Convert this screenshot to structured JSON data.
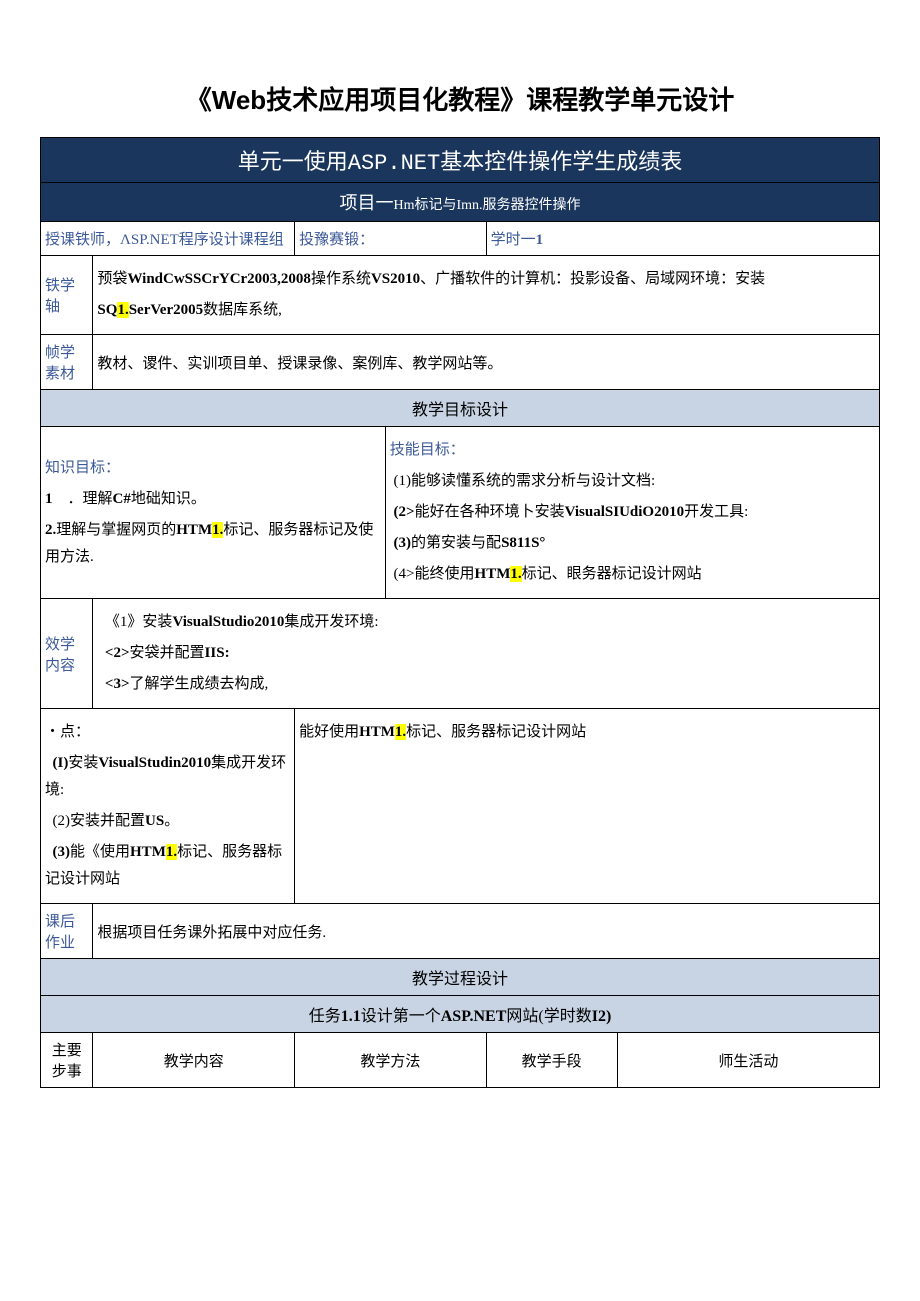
{
  "title": "《Web技术应用项目化教程》课程教学单元设计",
  "banner_pre": "单元一使用",
  "banner_mid": "ASP.NET",
  "banner_post": "基本控件操作学生成绩表",
  "subbanner_pre": "项目一",
  "subbanner_mid1": "Hm",
  "subbanner_mid2": "标记与",
  "subbanner_mid3": "Imn.服务器",
  "subbanner_post": "控件操作",
  "info_teacher": "授课铁师，ΛSP.NET程序设计课程组",
  "info_cast": "投豫赛锻：",
  "info_hours_label": "学时一",
  "info_hours_val": "1",
  "row_env_label": "铁学轴",
  "row_env_1a": "预袋",
  "row_env_1b": "WindCwSSCrYCr2003,2008",
  "row_env_1c": "操作系统",
  "row_env_1d": "VS2010",
  "row_env_1e": "、广播软件的计算机：投影设备、局域网环境：安装",
  "row_env_2a": "SQ",
  "row_env_2b": "1.",
  "row_env_2c": "SerVer2005",
  "row_env_2d": "数据库系统,",
  "row_mat_label": "帧学素材",
  "row_mat_text": "教材、谡件、实训项目单、授课录像、案例库、教学网站等。",
  "section_goal": "教学目标设计",
  "know_title": "知识目标：",
  "know_1_a": "1",
  "know_1_b": "．理解",
  "know_1_c": "C#",
  "know_1_d": "地础知识。",
  "know_2_a": "2.",
  "know_2_b": "理解与掌握网页的",
  "know_2_c": "HTM",
  "know_2_d": "1.",
  "know_2_e": "标记、服务器标记及使用方法.",
  "skill_title": "技能目标：",
  "skill_1": "(1)能够读懂系统的需求分析与设计文档:",
  "skill_2a": "(2>",
  "skill_2b": "能好在各种环境卜安装",
  "skill_2c": "VisualSIUdiO2010",
  "skill_2d": "开发工具:",
  "skill_3a": "(3)",
  "skill_3b": "的第安装与配",
  "skill_3c": "S811S°",
  "skill_4a": "(4>",
  "skill_4b": "能终使用",
  "skill_4c": "HTM",
  "skill_4d": "1.",
  "skill_4e": "标记、眼务器标记设计网站",
  "content_label": "效学内容",
  "content_1a": "《1》安装",
  "content_1b": "VisualStudio2010",
  "content_1c": "集成开发环境:",
  "content_2a": "<2>",
  "content_2b": "安袋并配置",
  "content_2c": "IIS:",
  "content_3a": "<3>",
  "content_3b": "了解学生成绩去构成,",
  "kp_title": "・点：",
  "kp_1a": "(I)",
  "kp_1b": "安装",
  "kp_1c": "VisualStudin2010",
  "kp_1d": "集成开发环境:",
  "kp_2a": "(2)安装并配置",
  "kp_2b": "US",
  "kp_2c": "。",
  "kp_3a": "(3)",
  "kp_3b": "能《使用",
  "kp_3c": "HTM",
  "kp_3d": "1.",
  "kp_3e": "标记、服务器标记设计网站",
  "kp2_a": "能好使用",
  "kp2_b": "HTM",
  "kp2_c": "1.",
  "kp2_d": "标记、服务器标记设计网站",
  "hw_label": "课后作业",
  "hw_text": "根据项目任务课外拓展中对应任务.",
  "section_process": "教学过程设计",
  "task_a": "任务",
  "task_b": "1.1",
  "task_c": "设计第一个",
  "task_d": "ASP.NET",
  "task_e": "网站(学时数",
  "task_f": "I2)",
  "col1": "主要步事",
  "col2": "教学内容",
  "col3": "教学方法",
  "col4": "教学手段",
  "col5": "师生活动"
}
